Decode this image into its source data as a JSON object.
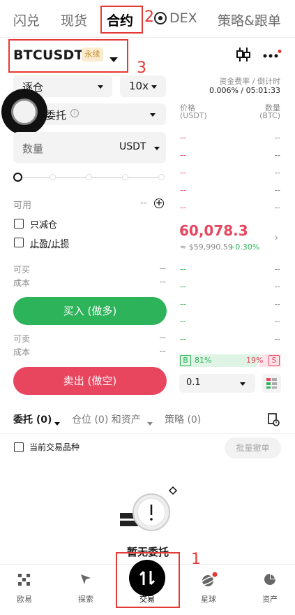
{
  "nav": {
    "items": [
      "闪兑",
      "现货",
      "合约",
      "DEX",
      "策略&跟单"
    ],
    "dex_icon": "soccer-ball-icon"
  },
  "annotations": {
    "n1": "1",
    "n2": "2",
    "n3": "3"
  },
  "pair": {
    "symbol": "BTCUSDT",
    "badge": "永续"
  },
  "header_icons": {
    "chart": "candlestick-icon",
    "more": "more-dots-icon"
  },
  "funding": {
    "label": "资金费率 / 倒计时",
    "value": "0.006% / 05:01:33"
  },
  "order_form": {
    "margin_mode": "逐仓",
    "leverage": "10x",
    "order_type": "委托",
    "qty_label": "数量",
    "qty_unit": "USDT",
    "available_label": "可用",
    "available_value": "--",
    "reduce_only": "只减仓",
    "tp_sl": "止盈/止损",
    "can_buy_label": "可买",
    "can_buy_value": "--",
    "cost_label": "成本",
    "cost_value": "--",
    "buy_button": "买入 (做多)",
    "can_sell_label": "可卖",
    "can_sell_value": "--",
    "cost2_label": "成本",
    "cost2_value": "--",
    "sell_button": "卖出 (做空)",
    "slider_level": 0
  },
  "orderbook": {
    "price_header": "价格",
    "price_unit": "(USDT)",
    "qty_header": "数量",
    "qty_unit": "(BTC)",
    "dash": "--",
    "last_price": "60,078.3",
    "index_price": "≈ $59,990.59",
    "change": "+0.30%",
    "buy_ratio": "81%",
    "sell_ratio": "19%",
    "buy_tag": "B",
    "sell_tag": "S",
    "depth": "0.1"
  },
  "tabs": {
    "orders": "委托 (0)",
    "positions": "仓位 (0) 和资产",
    "strategy": "策略 (0)",
    "current_pair": "当前交易品种",
    "cancel_all": "批量撤单"
  },
  "empty": {
    "text": "暂无委托"
  },
  "bottom_nav": [
    "欧易",
    "探索",
    "交易",
    "星球",
    "资产"
  ],
  "colors": {
    "buy": "#2db35a",
    "sell": "#e8455f",
    "annotation": "#e53935"
  }
}
